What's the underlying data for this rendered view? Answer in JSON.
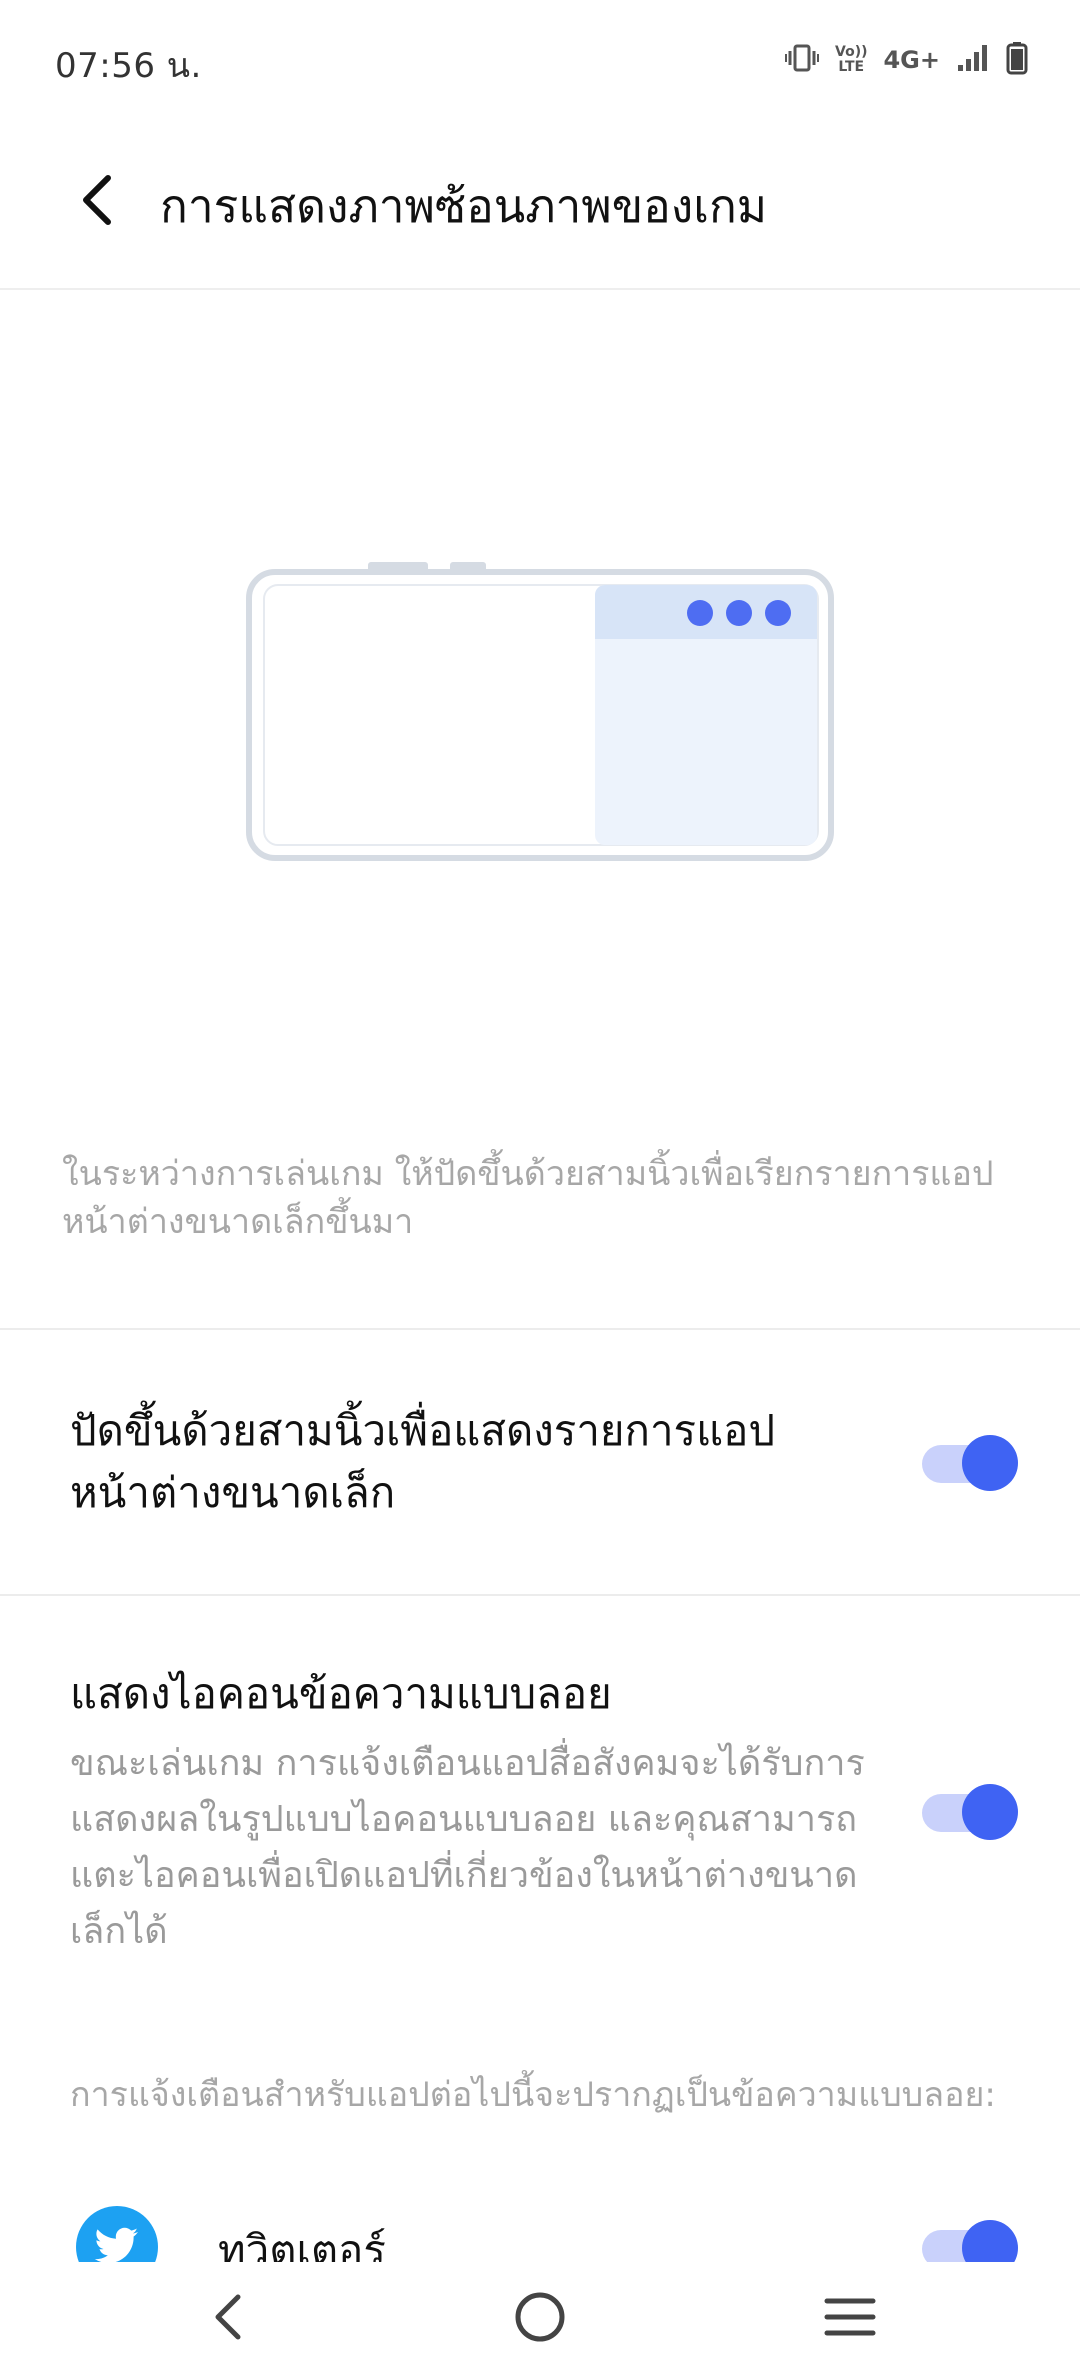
{
  "status_bar": {
    "time": "07:56 น.",
    "volte_top": "Vo))",
    "volte_bottom": "LTE",
    "network": "4G+"
  },
  "header": {
    "title": "การแสดงภาพซ้อนภาพของเกม"
  },
  "description": "ในระหว่างการเล่นเกม ให้ปัดขึ้นด้วยสามนิ้วเพื่อเรียกรายการแอปหน้าต่างขนาดเล็กขึ้นมา",
  "settings": [
    {
      "title": "ปัดขึ้นด้วยสามนิ้วเพื่อแสดงรายการแอปหน้าต่างขนาดเล็ก",
      "enabled": true
    },
    {
      "title": "แสดงไอคอนข้อความแบบลอย",
      "description": "ขณะเล่นเกม การแจ้งเตือนแอปสื่อสังคมจะได้รับการแสดงผลในรูปแบบไอคอนแบบลอย และคุณสามารถแตะไอคอนเพื่อเปิดแอปที่เกี่ยวข้องในหน้าต่างขนาดเล็กได้",
      "enabled": true
    }
  ],
  "apps_note": "การแจ้งเตือนสำหรับแอปต่อไปนี้จะปรากฏเป็นข้อความแบบลอย:",
  "apps": [
    {
      "name": "ทวิตเตอร์",
      "icon": "twitter-bird-icon",
      "enabled": true
    }
  ],
  "colors": {
    "accent": "#3f63f3",
    "accent_track": "#c9d1fb",
    "twitter": "#1da1f2",
    "secondary_text": "#a7a7a7"
  }
}
